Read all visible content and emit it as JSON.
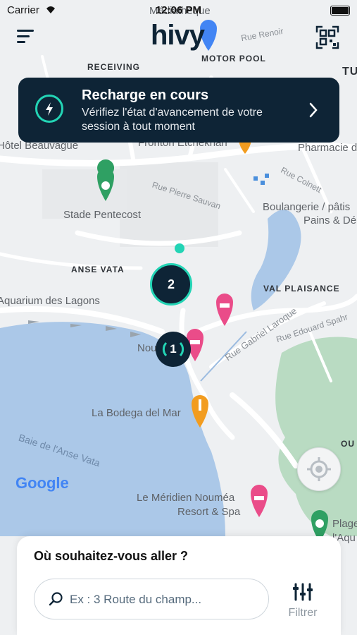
{
  "status_bar": {
    "carrier": "Carrier",
    "time": "12:06 PM"
  },
  "header": {
    "logo_text": "hivy"
  },
  "banner": {
    "title": "Recharge en cours",
    "subtitle": "Vérifiez l'état d'avancement de votre session à tout moment"
  },
  "map": {
    "area_labels": [
      "RECEIVING",
      "MOTOR POOL",
      "ANSE VATA",
      "VAL PLAISANCE",
      "OU",
      "TU"
    ],
    "places": [
      "Stade Pentecost",
      "Aquarium des Lagons",
      "Hôtel Beauvague",
      "Fronton Etchekhan",
      "Pharmacie d",
      "Boulangerie / pâtis",
      "Pains & Dé",
      "La Bodega del Mar",
      "Le Méridien Nouméa",
      "Resort & Spa",
      "Plage",
      "l'Aqu",
      "Nou",
      "Médiathèque"
    ],
    "streets": [
      "Rue Renoir",
      "Rue Pierre Sauvan",
      "Rue Colnett",
      "Rue Gabriel Laroque",
      "Rue Edouard Spahr",
      "Baie de l'Anse Vata"
    ],
    "clusters": [
      {
        "count": "2"
      },
      {
        "count": "1"
      }
    ],
    "attribution": "Google",
    "colors": {
      "water": "#abc8e8",
      "park": "#b9dbc2",
      "accent": "#23d4b5",
      "navy": "#0e2436"
    }
  },
  "bottom_sheet": {
    "question": "Où souhaitez-vous aller ?",
    "search_placeholder": "Ex : 3 Route du champ...",
    "filter_label": "Filtrer"
  }
}
